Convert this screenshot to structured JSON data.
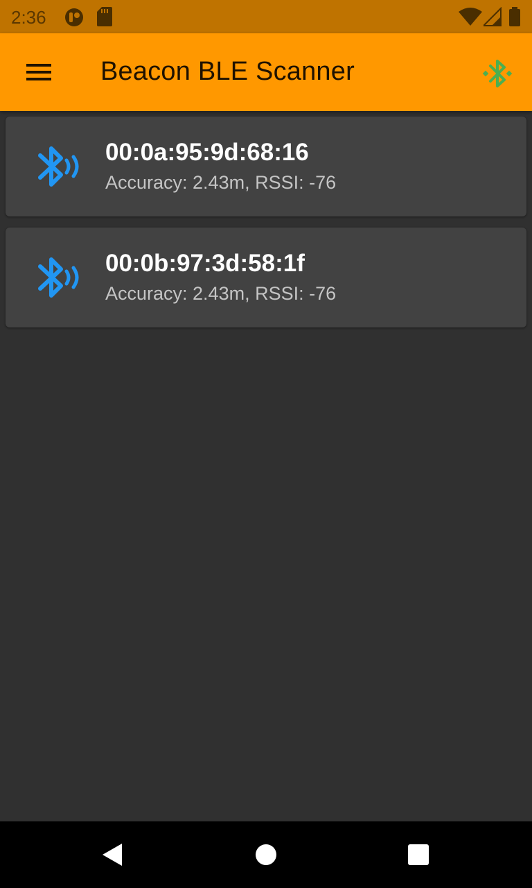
{
  "status_bar": {
    "time": "2:36",
    "icons": [
      "app-notification-icon",
      "sd-card-icon",
      "wifi-icon",
      "signal-icon",
      "battery-icon"
    ]
  },
  "app_bar": {
    "title": "Beacon BLE Scanner",
    "menu_icon": "hamburger-menu-icon",
    "action_icon": "bluetooth-searching-icon",
    "color": "#ff9800"
  },
  "beacons": [
    {
      "mac": "00:0a:95:9d:68:16",
      "details": "Accuracy: 2.43m, RSSI: -76",
      "icon": "bluetooth-audio-icon"
    },
    {
      "mac": "00:0b:97:3d:58:1f",
      "details": "Accuracy: 2.43m, RSSI: -76",
      "icon": "bluetooth-audio-icon"
    }
  ],
  "colors": {
    "background": "#303030",
    "card": "#424242",
    "beacon_icon": "#2196f3",
    "scan_icon": "#4caf50",
    "status_bar": "#bf7300"
  },
  "nav_bar": {
    "buttons": [
      "back-icon",
      "home-icon",
      "recents-icon"
    ]
  }
}
